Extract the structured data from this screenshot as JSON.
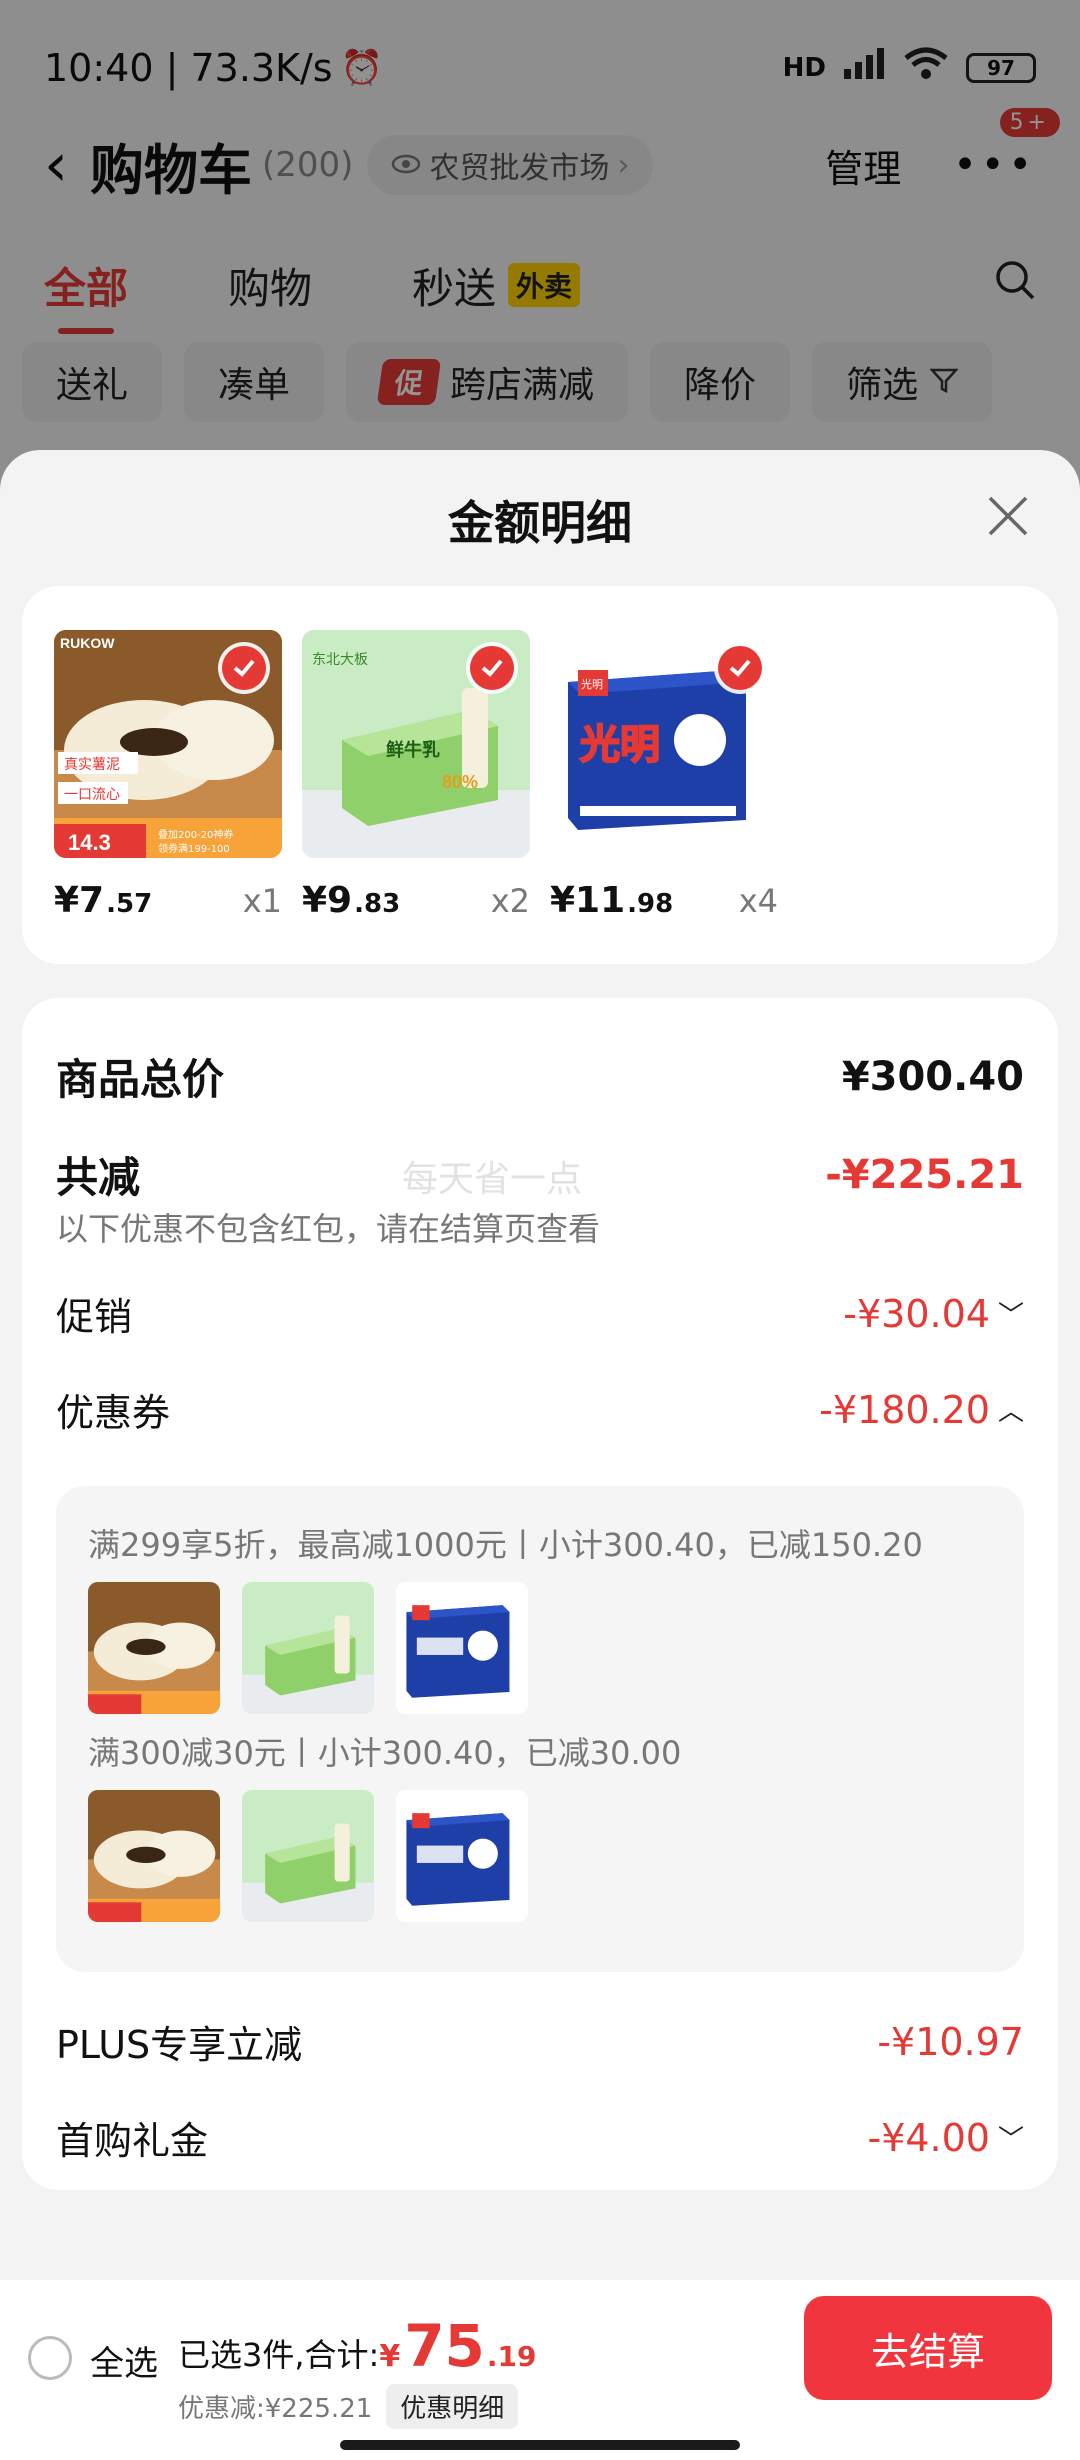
{
  "status_bar": {
    "time": "10:40 | 73.3K/s",
    "network": "HD",
    "battery": "97"
  },
  "nav": {
    "title": "购物车",
    "count": "(200)",
    "market": "农贸批发市场",
    "manage": "管理",
    "badge": "5+"
  },
  "tabs": [
    {
      "label": "全部"
    },
    {
      "label": "购物"
    },
    {
      "label": "秒送",
      "tag": "外卖"
    }
  ],
  "chips": [
    {
      "label": "送礼"
    },
    {
      "label": "凑单"
    },
    {
      "label": "跨店满减",
      "promo": "促"
    },
    {
      "label": "降价"
    },
    {
      "label": "筛选"
    }
  ],
  "sheet": {
    "title": "金额明细"
  },
  "products": [
    {
      "price_int": "¥7",
      "price_dec": ".57",
      "qty": "x1",
      "img": "mochi-icecream-image",
      "img_texts": [
        "RUKOW",
        "真实薯泥",
        "一口流心",
        "14.3",
        "叠加200-20神券",
        "领券满199-100"
      ]
    },
    {
      "price_int": "¥9",
      "price_dec": ".83",
      "qty": "x2",
      "img": "milk-popsicle-box-image",
      "img_texts": [
        "东北大板",
        "鲜牛乳",
        "80%"
      ]
    },
    {
      "price_int": "¥11",
      "price_dec": ".98",
      "qty": "x4",
      "img": "guangming-icecream-box-image",
      "img_texts": [
        "光明",
        "光明"
      ]
    }
  ],
  "summary": {
    "total_label": "商品总价",
    "total_value": "¥300.40",
    "reduce_label": "共减",
    "reduce_value": "-¥225.21",
    "reduce_note": "以下优惠不包含红包，请在结算页查看",
    "watermark": "每天省一点",
    "promo_label": "促销",
    "promo_value": "-¥30.04",
    "coupon_label": "优惠券",
    "coupon_value": "-¥180.20",
    "coupon_lines": [
      "满299享5折，最高减1000元丨小计300.40，已减150.20",
      "满300减30元丨小计300.40，已减30.00"
    ],
    "plus_label": "PLUS专享立减",
    "plus_value": "-¥10.97",
    "gift_label": "首购礼金",
    "gift_value": "-¥4.00"
  },
  "footer": {
    "select_all": "全选",
    "selected_text": "已选3件,合计:",
    "total_symbol": "¥",
    "total_int": "75",
    "total_dec": ".19",
    "discount_text": "优惠减:¥225.21",
    "detail_button": "优惠明细",
    "checkout": "去结算"
  },
  "colors": {
    "accent": "#e53935",
    "checkout": "#f0353e"
  }
}
